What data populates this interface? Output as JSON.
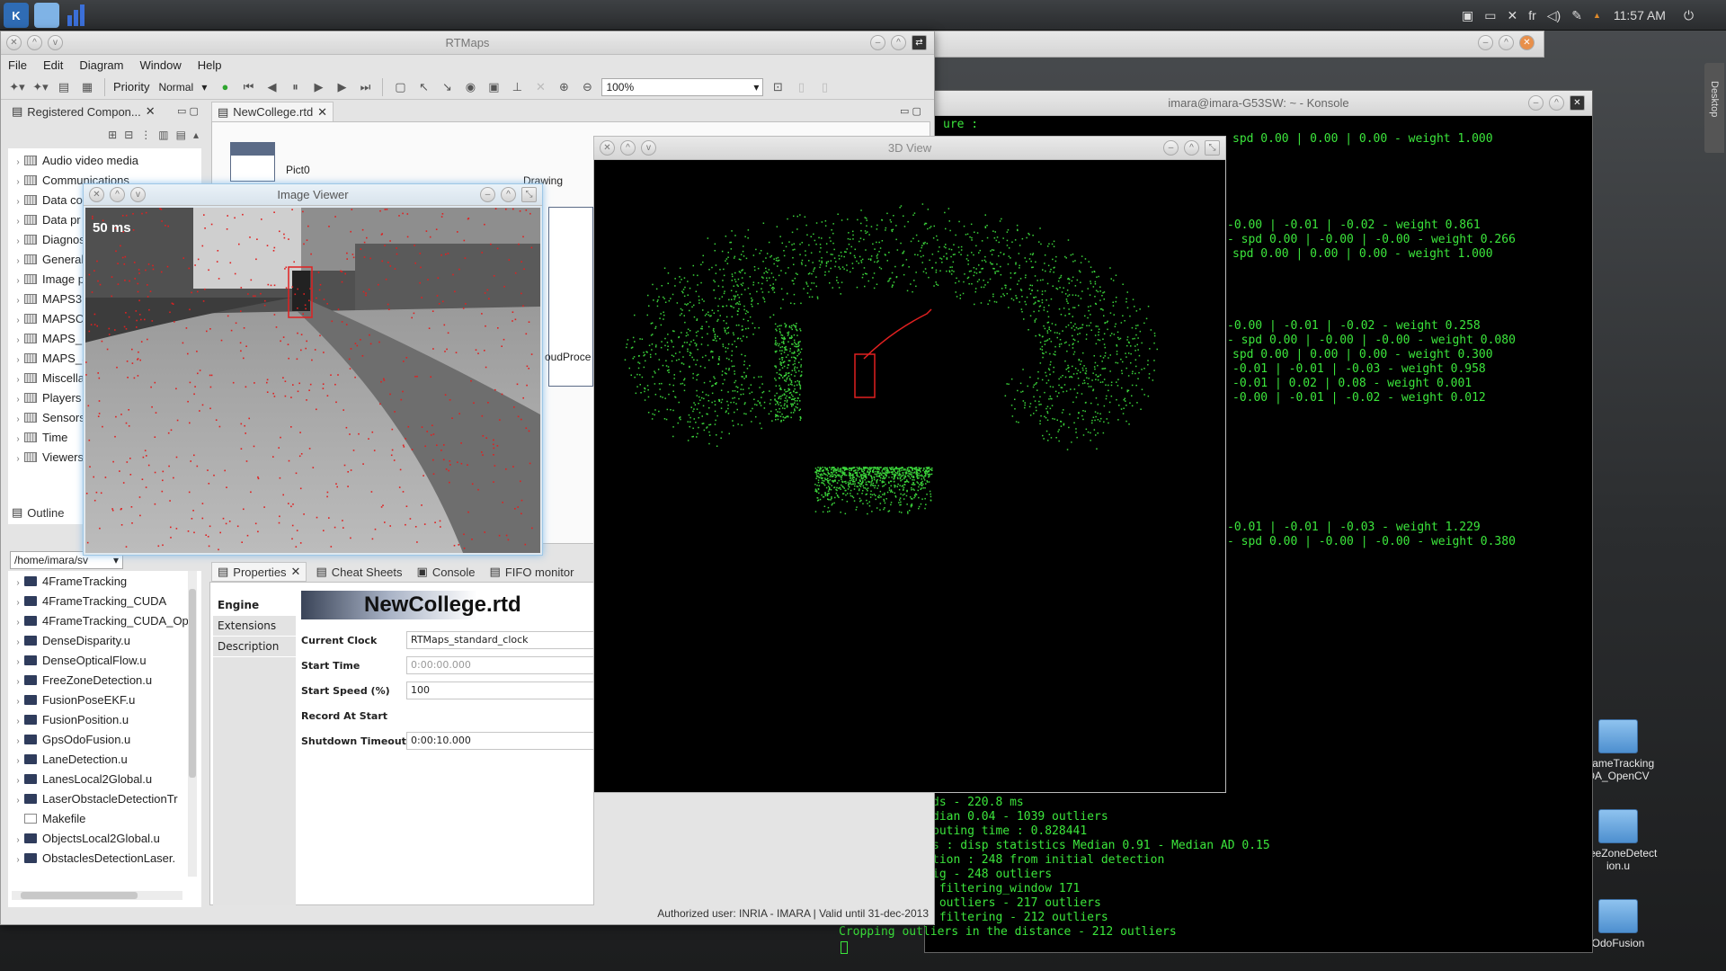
{
  "topbar": {
    "clock": "11:57 AM",
    "keyboard_layout": "fr",
    "icons": [
      "kde-menu-icon",
      "file-manager-icon",
      "system-monitor-icon",
      "notification-icon",
      "screen-icon",
      "network-icon",
      "volume-icon",
      "pen-icon",
      "arrow-icon",
      "power-icon"
    ]
  },
  "rtmaps": {
    "title": "RTMaps",
    "menu": [
      "File",
      "Edit",
      "Diagram",
      "Window",
      "Help"
    ],
    "toolbar": {
      "priority_label": "Priority",
      "priority_value": "Normal",
      "zoom_value": "100%"
    },
    "registered_tab": "Registered Compon...",
    "editor_tab": "NewCollege.rtd",
    "components": [
      "Audio video media",
      "Communications",
      "Data co",
      "Data pr",
      "Diagnos",
      "General",
      "Image p",
      "MAPS3D",
      "MAPSC",
      "MAPS_F",
      "MAPS_S",
      "Miscella",
      "Players",
      "Sensors",
      "Time",
      "Viewers"
    ],
    "outline_tab": "Outline",
    "path_value": "/home/imara/sv",
    "files": [
      {
        "name": "4FrameTracking",
        "type": "folder"
      },
      {
        "name": "4FrameTracking_CUDA",
        "type": "folder"
      },
      {
        "name": "4FrameTracking_CUDA_Op",
        "type": "folder"
      },
      {
        "name": "DenseDisparity.u",
        "type": "folder"
      },
      {
        "name": "DenseOpticalFlow.u",
        "type": "folder"
      },
      {
        "name": "FreeZoneDetection.u",
        "type": "folder"
      },
      {
        "name": "FusionPoseEKF.u",
        "type": "folder"
      },
      {
        "name": "FusionPosition.u",
        "type": "folder"
      },
      {
        "name": "GpsOdoFusion.u",
        "type": "folder"
      },
      {
        "name": "LaneDetection.u",
        "type": "folder"
      },
      {
        "name": "LanesLocal2Global.u",
        "type": "folder"
      },
      {
        "name": "LaserObstacleDetectionTr",
        "type": "folder"
      },
      {
        "name": "Makefile",
        "type": "file"
      },
      {
        "name": "ObjectsLocal2Global.u",
        "type": "folder"
      },
      {
        "name": "ObstaclesDetectionLaser.",
        "type": "folder"
      }
    ],
    "diagram": {
      "block1": "Pict0",
      "block2": "Drawing",
      "block3": "oudProce"
    },
    "bottom_tabs": [
      "Properties",
      "Cheat Sheets",
      "Console",
      "FIFO monitor"
    ],
    "properties": {
      "title": "NewCollege.rtd",
      "side_tabs": [
        "Engine",
        "Extensions",
        "Description"
      ],
      "fields": [
        {
          "label": "Current Clock",
          "value": "RTMaps_standard_clock"
        },
        {
          "label": "Start Time",
          "value": "0:00:00.000"
        },
        {
          "label": "Start Speed (%)",
          "value": "100"
        },
        {
          "label": "Record At Start",
          "value": ""
        },
        {
          "label": "Shutdown Timeout",
          "value": "0:00:10.000"
        }
      ]
    },
    "status": "Authorized user: INRIA - IMARA | Valid until 31-dec-2013"
  },
  "image_viewer": {
    "title": "Image Viewer",
    "overlay_text": "50 ms"
  },
  "view3d": {
    "title": "3D View"
  },
  "konsole": {
    "title": "imara@imara-G53SW: ~ - Konsole",
    "top_lines": [
      "ure :",
      "spd 0.00 | 0.00 | 0.00 - weight 1.000",
      "-0.00 | -0.01 | -0.02 - weight 0.861",
      "- spd 0.00 | -0.00 | -0.00 - weight 0.266",
      "spd 0.00 | 0.00 | 0.00 - weight 1.000",
      "-0.00 | -0.01 | -0.02 - weight 0.258",
      "- spd 0.00 | -0.00 | -0.00 - weight 0.080",
      "spd 0.00 | 0.00 | 0.00 - weight 0.300",
      "-0.01 | -0.01 | -0.03 - weight 0.958",
      "-0.01 | 0.02 | 0.08 - weight 0.001",
      "-0.00 | -0.01 | -0.02 - weight 0.012",
      "-0.01 | -0.01 | -0.03 - weight 1.229",
      "- spd 0.00 | -0.00 | -0.00 - weight 0.380"
    ],
    "bottom_lines": [
      "ds - 220.8 ms",
      "dian 0.04 - 1039 outliers",
      "puting time : 0.828441",
      "s : disp statistics Median 0.91 - Median AD 0.15",
      "tion : 248 from initial detection",
      "ig - 248 outliers",
      " filtering_window 171",
      " outliers - 217 outliers",
      " filtering - 212 outliers",
      "Cropping outliers in the distance - 212 outliers"
    ]
  },
  "desktop": {
    "side_label": "Desktop",
    "icons": [
      "FrameTracking\nDA_OpenCV",
      "FreeZoneDetect\nion.u",
      "OdoFusion"
    ]
  }
}
